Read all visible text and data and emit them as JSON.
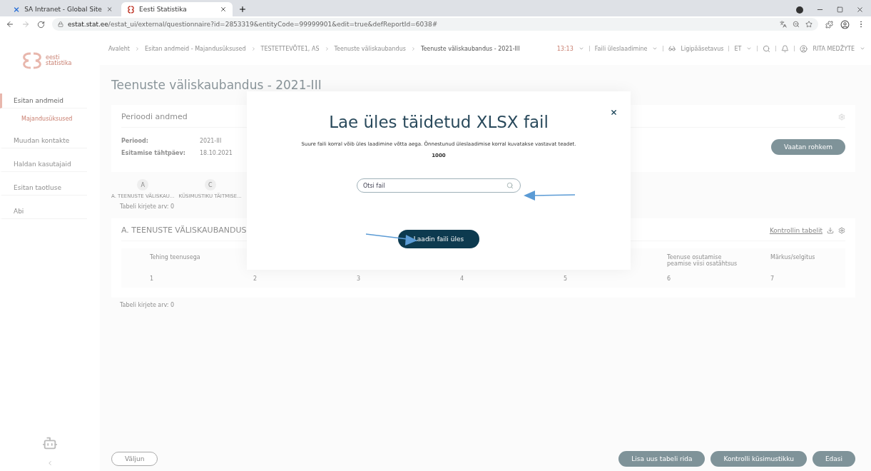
{
  "browser": {
    "tabs": [
      {
        "title": "SA Intranet - Global Site",
        "selected": false,
        "kind": "intranet"
      },
      {
        "title": "Eesti Statistika",
        "selected": true,
        "kind": "stat"
      }
    ],
    "url_host": "estat.stat.ee",
    "url_path": "/estat_ui/external/questionnaire?id=2853319&entityCode=99999901&edit=true&defReportId=6038#"
  },
  "sidebar": {
    "logo": "eesti statistika",
    "items": [
      {
        "label": "Esitan andmeid",
        "selected": true,
        "children": [
          {
            "label": "Majandusüksused",
            "selected": true
          }
        ]
      },
      {
        "label": "Muudan kontakte",
        "selected": false
      },
      {
        "label": "Haldan kasutajaid",
        "selected": false
      },
      {
        "label": "Esitan taotluse",
        "selected": false
      },
      {
        "label": "Abi",
        "selected": false
      }
    ]
  },
  "header": {
    "breadcrumbs": [
      "Avaleht",
      "Esitan andmeid - Majandusüksused",
      "TESTETTEVÕTE1, AS",
      "Teenuste väliskaubandus",
      "Teenuste väliskaubandus - 2021-III"
    ],
    "time": "13:13",
    "upload_menu": "Faili üleslaadimine",
    "accessibility": "Ligipääsetavus",
    "language": "ET",
    "user": "RITA MEDŽYTE"
  },
  "page_title": "Teenuste väliskaubandus - 2021-III",
  "period_card": {
    "title": "Perioodi andmed",
    "fields": [
      {
        "label": "Periood:",
        "value": "2021-III"
      },
      {
        "label": "Esitamise tähtpäev:",
        "value": "18.10.2021"
      }
    ],
    "button": "Vaatan rohkem"
  },
  "steps": [
    {
      "letter": "A",
      "label": "A. TEENUSTE VÄLISKAU..."
    },
    {
      "letter": "C",
      "label": "KÜSIMUSTIKU TÄITMISE..."
    }
  ],
  "steps_count": "Tabeli kirjete arv: 0",
  "table_card": {
    "title": "A. TEENUSTE VÄLISKAUBANDUS",
    "link": "Kontrollin tabelit",
    "columns": [
      {
        "header": "Tehing teenusega",
        "number": "1"
      },
      {
        "number": "2"
      },
      {
        "number": "3"
      },
      {
        "number": "4"
      },
      {
        "number": "5"
      },
      {
        "header": "Teenuse osutamise peamise viisi osatähtsus",
        "number": "6"
      },
      {
        "header": "Märkus/selgitus",
        "number": "7"
      }
    ]
  },
  "table_count": "Tabeli kirjete arv: 0",
  "footer": {
    "exit": "Väljun",
    "actions": [
      "Lisa uus tabeli rida",
      "Kontrolli küsimustikku",
      "Edasi"
    ]
  },
  "modal": {
    "title": "Lae üles täidetud XLSX fail",
    "description": "Suure faili korral võib üles laadimine võtta aega. Õnnestunud üleslaadimise korral kuvatakse vastavat teadet.",
    "limit": "1000",
    "search_placeholder": "Otsi fail",
    "button": "Laadin faili üles"
  }
}
